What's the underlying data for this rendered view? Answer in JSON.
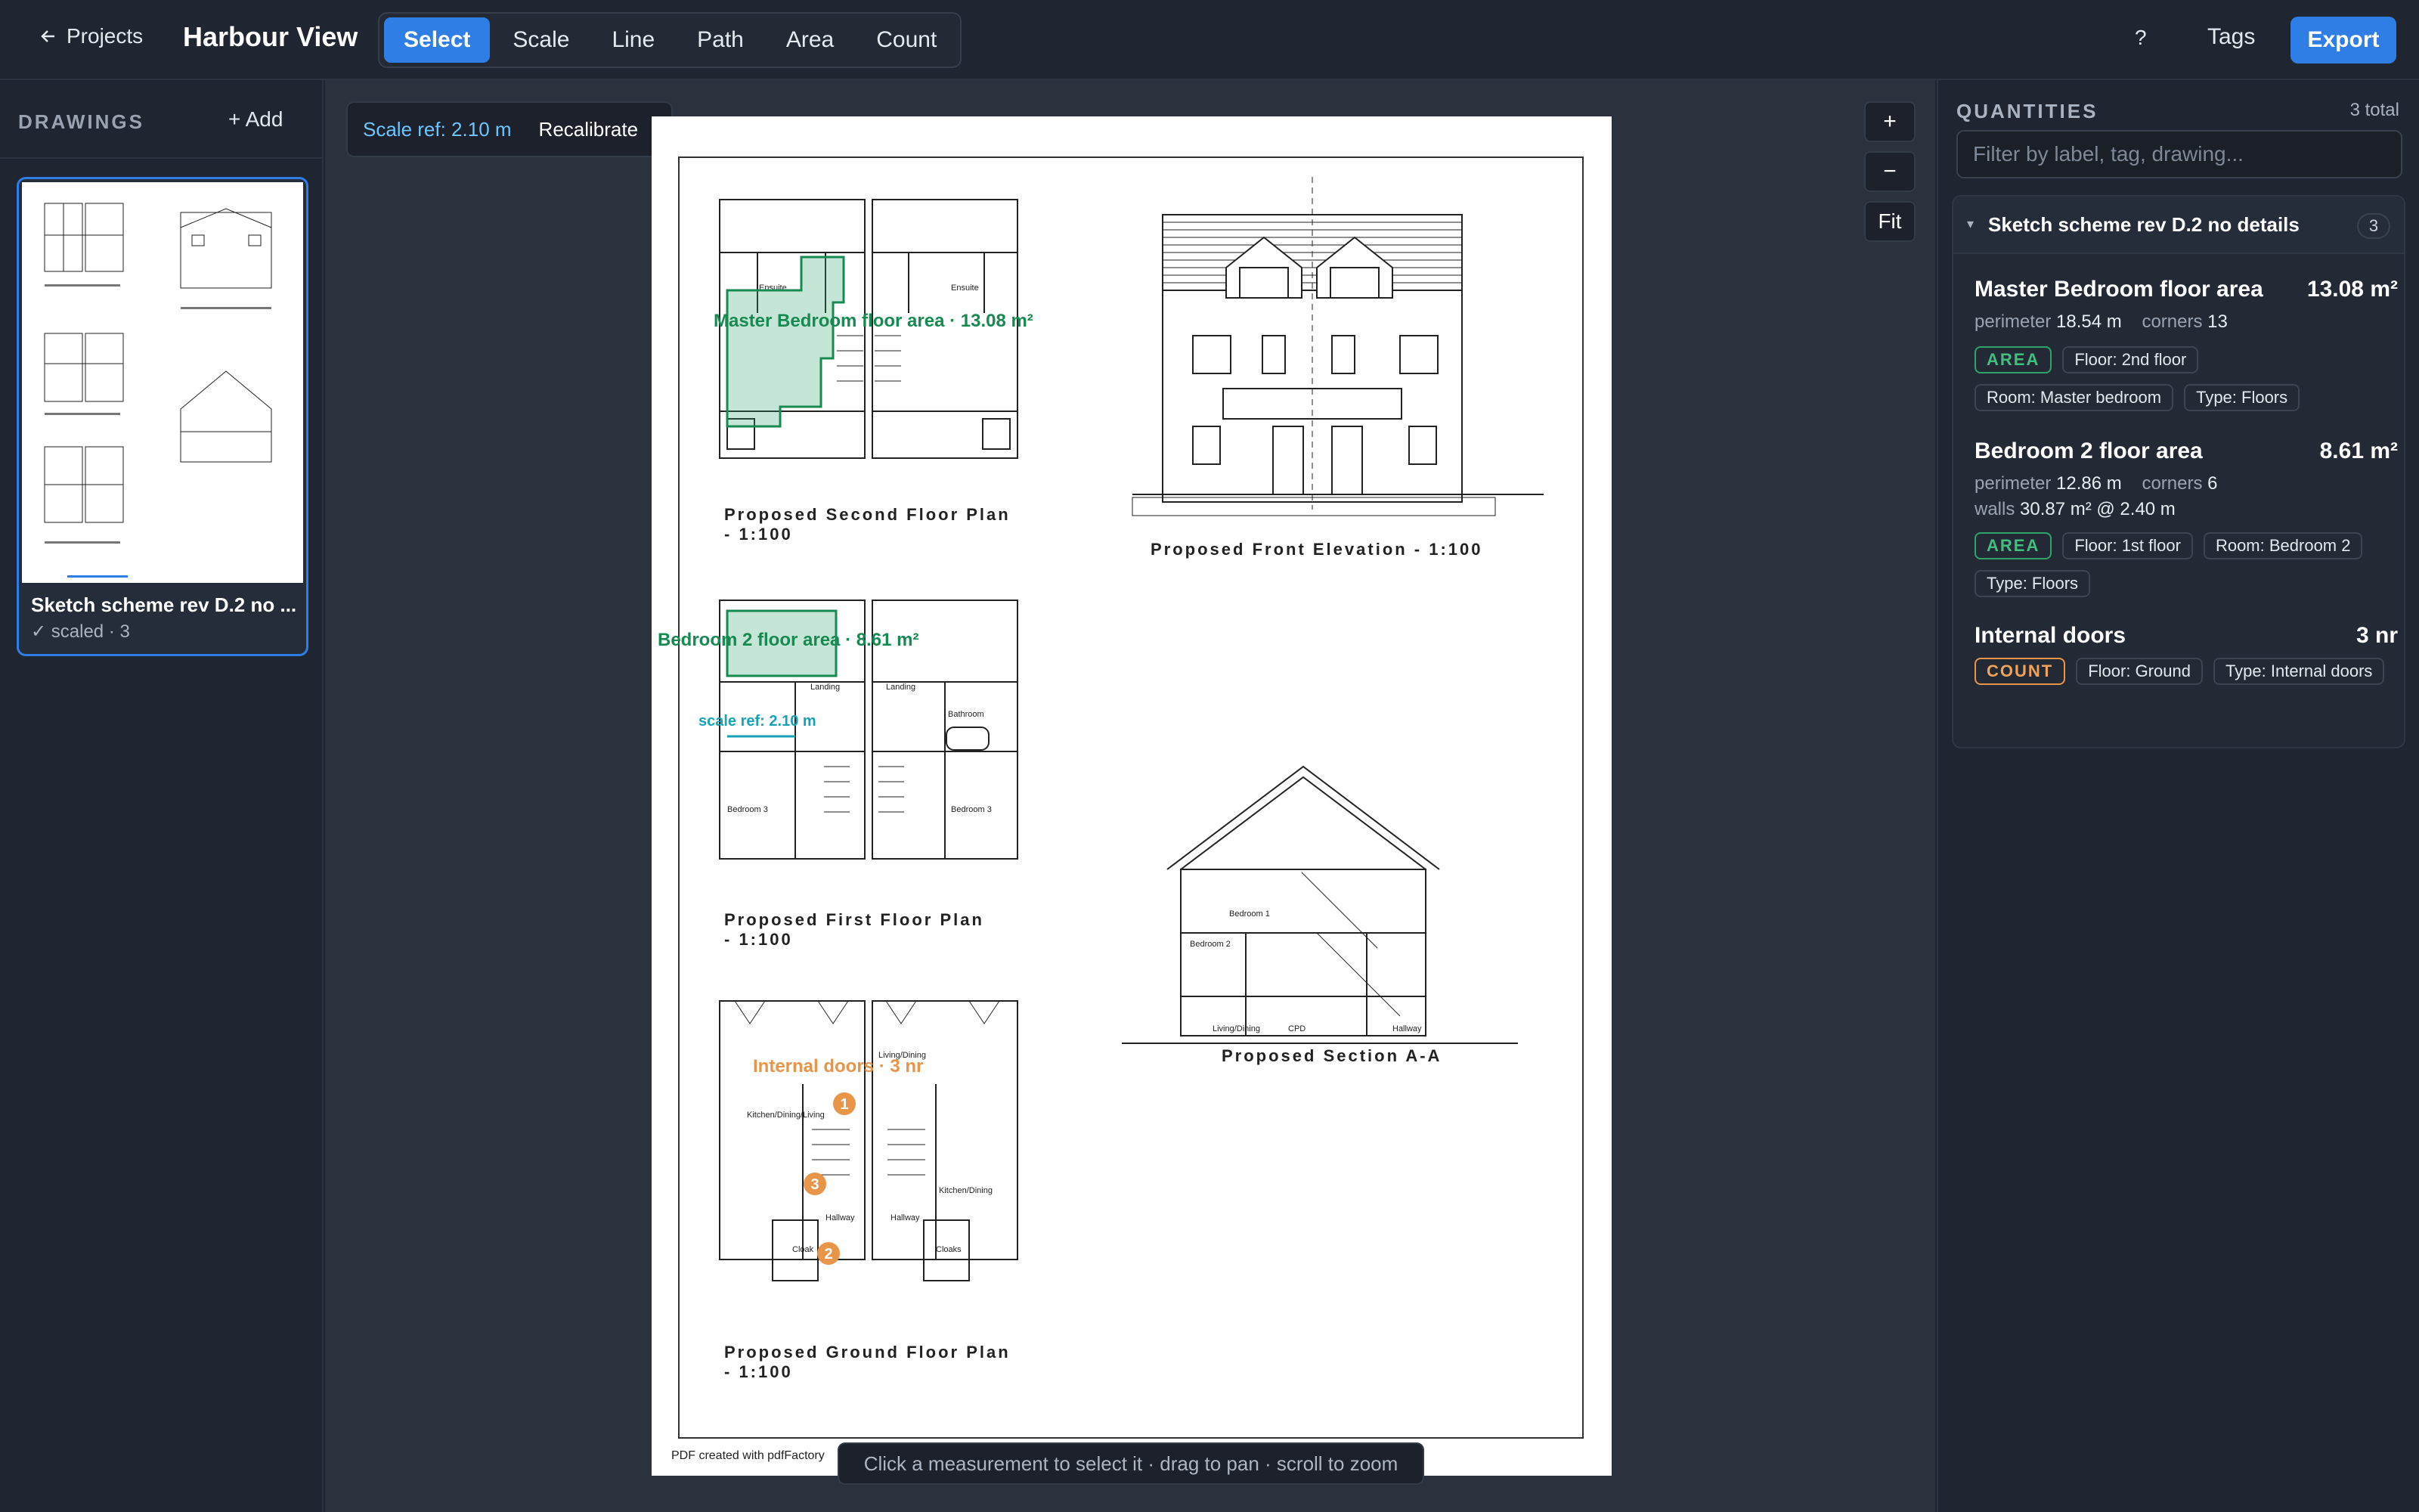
{
  "app": {
    "back_label": "Projects",
    "project_title": "Harbour View",
    "tools": [
      "Select",
      "Scale",
      "Line",
      "Path",
      "Area",
      "Count"
    ],
    "active_tool": "Select",
    "help_label": "?",
    "tags_label": "Tags",
    "export_label": "Export"
  },
  "sidebar": {
    "heading": "DRAWINGS",
    "add_label": "+ Add",
    "drawing": {
      "title": "Sketch scheme rev D.2 no ...",
      "status": "✓ scaled · 3"
    }
  },
  "canvas": {
    "scale_ref_label": "Scale ref: 2.10 m",
    "recalibrate_label": "Recalibrate",
    "zoom_in_label": "+",
    "zoom_out_label": "−",
    "fit_label": "Fit",
    "hint": "Click a measurement to select it · drag to pan · scroll to zoom",
    "overlays": {
      "master_area": "Master Bedroom floor area · 13.08 m²",
      "bed2_area": "Bedroom 2 floor area · 8.61 m²",
      "scale_ref": "scale ref: 2.10 m",
      "doors_count": "Internal doors · 3 nr",
      "marker_labels": [
        "1",
        "2",
        "3"
      ]
    },
    "drawing_text": {
      "second_floor": [
        "Proposed Second Floor Plan",
        "- 1:100"
      ],
      "front_elevation": "Proposed Front Elevation - 1:100",
      "first_floor": [
        "Proposed First Floor Plan",
        "- 1:100"
      ],
      "section": "Proposed Section A-A",
      "ground_floor": [
        "Proposed Ground Floor Plan",
        "- 1:100"
      ],
      "footer": "PDF created with pdfFactory",
      "rooms": {
        "ensuite": "Ensuite",
        "landing": "Landing",
        "bathroom": "Bathroom",
        "bedroom3": "Bedroom 3",
        "bedroom2": "Bedroom 2",
        "living_dining": "Living/Dining",
        "kitchen_dining_living": "Kitchen/Dining/Living",
        "kitchen_dining": "Kitchen/Dining",
        "hallway": "Hallway",
        "cloak": "Cloak",
        "cloaks": "Cloaks",
        "cpd": "CPD",
        "bedroom1": "Bedroom 1"
      }
    }
  },
  "quantities": {
    "heading": "QUANTITIES",
    "total": "3 total",
    "filter_placeholder": "Filter by label, tag, drawing...",
    "group": {
      "title": "Sketch scheme rev D.2 no details",
      "count": "3",
      "items": [
        {
          "name": "Master Bedroom floor area",
          "value": "13.08 m²",
          "perimeter_label": "perimeter",
          "perimeter": "18.54 m",
          "corners_label": "corners",
          "corners": "13",
          "chips": [
            "AREA",
            "Floor: 2nd floor",
            "Room: Master bedroom",
            "Type: Floors"
          ]
        },
        {
          "name": "Bedroom 2 floor area",
          "value": "8.61 m²",
          "perimeter_label": "perimeter",
          "perimeter": "12.86 m",
          "corners_label": "corners",
          "corners": "6",
          "walls_label": "walls",
          "walls": "30.87 m² @ 2.40 m",
          "chips": [
            "AREA",
            "Floor: 1st floor",
            "Room: Bedroom 2",
            "Type: Floors"
          ]
        },
        {
          "name": "Internal doors",
          "value": "3 nr",
          "chips": [
            "COUNT",
            "Floor: Ground",
            "Type: Internal doors"
          ]
        }
      ]
    }
  },
  "colors": {
    "accent": "#2f7ee6",
    "area": "#2fa36b",
    "count": "#e8954a",
    "scale": "#17a2b8"
  }
}
